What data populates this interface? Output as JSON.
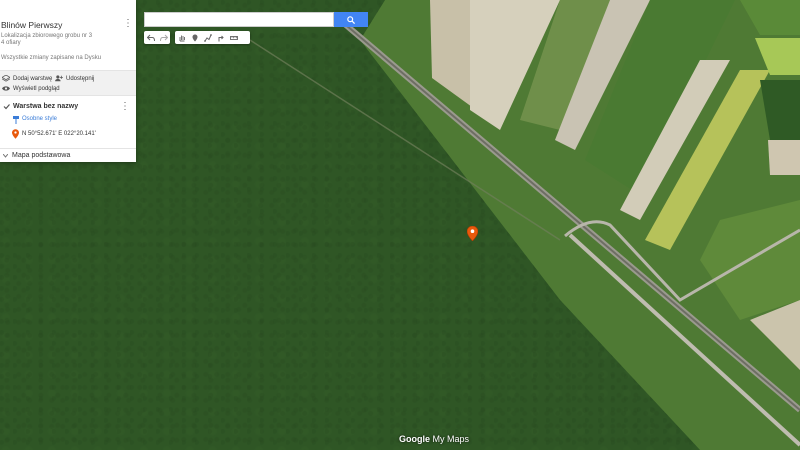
{
  "map": {
    "title": "Blinów Pierwszy",
    "description_line1": "Lokalizacja zbiorowego grobu nr 3",
    "description_line2": "4 ofiary",
    "save_status": "Wszystkie zmiany zapisane na Dysku",
    "actions": {
      "add_layer": "Dodaj warstwę",
      "share": "Udostępnij",
      "preview": "Wyświetl podgląd"
    }
  },
  "layer": {
    "name": "Warstwa bez nazwy",
    "style_link": "Osobne style",
    "point_label": "N 50°52.671' E 022°20.141'"
  },
  "basemap": {
    "label": "Mapa podstawowa"
  },
  "search": {
    "placeholder": "",
    "value": ""
  },
  "toolbar": {
    "icons": [
      "undo-icon",
      "redo-icon",
      "hand-icon",
      "add-marker-icon",
      "draw-line-icon",
      "directions-icon",
      "ruler-icon"
    ]
  },
  "branding": {
    "google": "Google",
    "my_maps": "My Maps"
  },
  "colors": {
    "accent": "#4285f4",
    "marker": "#e8590c",
    "link": "#3b7dd8",
    "forest": "#35602a"
  }
}
